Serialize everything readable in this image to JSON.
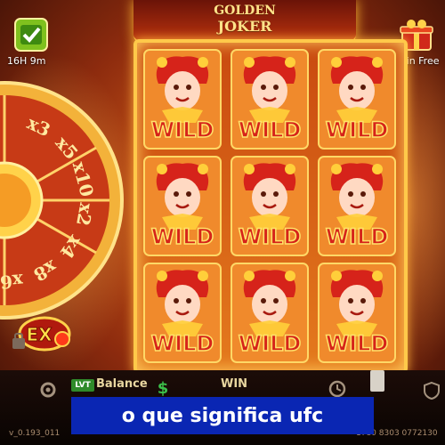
{
  "game": {
    "title_line1": "GOLDEN",
    "title_line2": "JOKER"
  },
  "top_left": {
    "label": "16H 9m",
    "icon": "jackpot-icon"
  },
  "top_right": {
    "label": "Win Free",
    "icon": "gift-icon"
  },
  "wheel": {
    "multipliers": [
      "x3",
      "x5",
      "x10",
      "x2",
      "x4",
      "x8",
      "x6"
    ]
  },
  "reels": {
    "symbol_text": "WILD",
    "grid": [
      [
        "WILD",
        "WILD",
        "WILD"
      ],
      [
        "WILD",
        "WILD",
        "WILD"
      ],
      [
        "WILD",
        "WILD",
        "WILD"
      ]
    ]
  },
  "ex_badge": "EX",
  "bottom": {
    "balance_chip": "LVT",
    "balance_label": "Balance",
    "win_label": "WIN",
    "version": "v_0.193_011",
    "version_right": "1780 8303 0772130"
  },
  "caption": "o que significa ufc",
  "colors": {
    "frame_gold": "#ffc94a",
    "caption_bg": "#0a26b3",
    "wild_red": "#d6231a"
  }
}
